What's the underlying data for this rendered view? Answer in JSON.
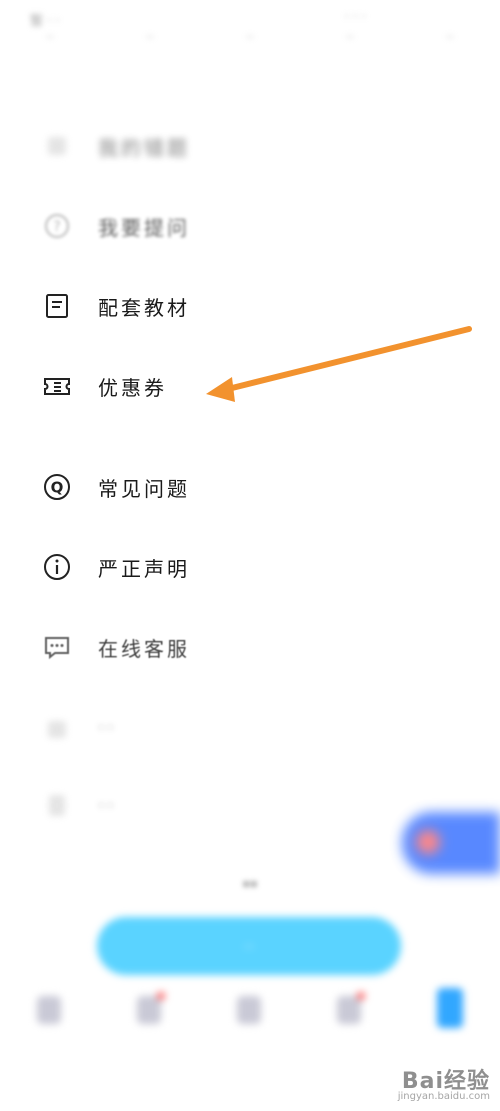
{
  "header": {
    "row1_left": "暂 · ·",
    "row1_right": "· · ·",
    "tabs": [
      "··",
      "··",
      "··",
      "··",
      "··"
    ]
  },
  "menu": [
    {
      "label": "我的错题",
      "icon": "doc-icon",
      "state": "blurred"
    },
    {
      "label": "我要提问",
      "icon": "question-circle-icon",
      "state": "blurred"
    },
    {
      "label": "配套教材",
      "icon": "book-icon",
      "state": "clear"
    },
    {
      "label": "优惠券",
      "icon": "coupon-ticket-icon",
      "state": "clear"
    },
    {
      "label": "常见问题",
      "icon": "faq-q-icon",
      "state": "clear"
    },
    {
      "label": "严正声明",
      "icon": "info-circle-icon",
      "state": "clear"
    },
    {
      "label": "在线客服",
      "icon": "chat-dots-icon",
      "state": "clear"
    },
    {
      "label": "··",
      "icon": "bag-icon",
      "state": "blurred"
    },
    {
      "label": "··",
      "icon": "doc-icon",
      "state": "blurred"
    }
  ],
  "annotation": {
    "arrow_color": "#f2922e"
  },
  "promo": {
    "title": "··",
    "button": "··"
  },
  "bottom_nav": {
    "items": [
      {
        "name": "home",
        "badge": false
      },
      {
        "name": "tab2",
        "badge": true
      },
      {
        "name": "tab3",
        "badge": false
      },
      {
        "name": "tab4",
        "badge": true
      },
      {
        "name": "me",
        "badge": false,
        "active": true
      }
    ]
  },
  "watermark": {
    "main": "Bai经验",
    "sub": "jingyan.baidu.com"
  },
  "colors": {
    "accent": "#2f6bff",
    "promo": "#5ad3ff",
    "arrow": "#f2922e"
  }
}
